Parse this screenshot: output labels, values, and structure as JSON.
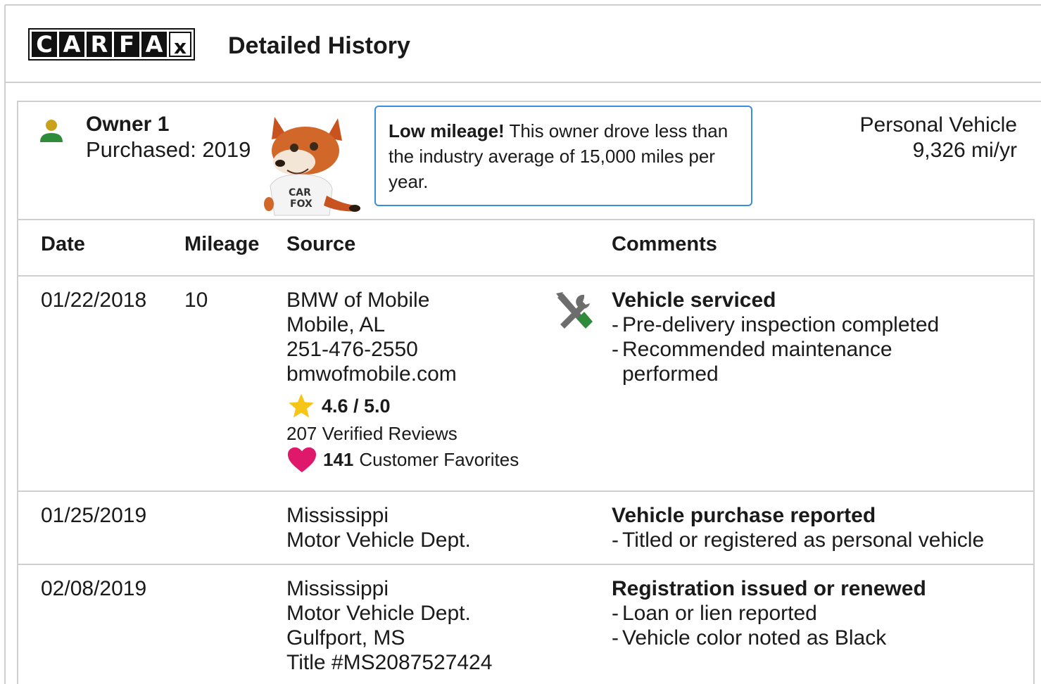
{
  "header": {
    "logo_letters": [
      "C",
      "A",
      "R",
      "F",
      "A",
      "x"
    ],
    "title": "Detailed History"
  },
  "owner": {
    "name": "Owner 1",
    "purchased": "Purchased: 2019",
    "fox_shirt_text": "CAR FOX"
  },
  "callout": {
    "bold": "Low mileage!",
    "text": " This owner drove less than the industry average of 15,000 miles per year."
  },
  "vehicle": {
    "type": "Personal Vehicle",
    "mileage_rate": "9,326 mi/yr"
  },
  "table": {
    "headers": {
      "date": "Date",
      "mileage": "Mileage",
      "source": "Source",
      "comments": "Comments"
    },
    "rows": [
      {
        "date": "01/22/2018",
        "mileage": "10",
        "source_lines": [
          "BMW of Mobile",
          "Mobile, AL",
          "251-476-2550",
          "bmwofmobile.com"
        ],
        "rating": "4.6 / 5.0",
        "reviews": "207 Verified Reviews",
        "favorites_count": "141",
        "favorites_label": "Customer Favorites",
        "comment_title": "Vehicle serviced",
        "comment_lines": [
          "Pre-delivery inspection completed",
          "Recommended maintenance performed"
        ]
      },
      {
        "date": "01/25/2019",
        "mileage": "",
        "source_lines": [
          "Mississippi",
          "Motor Vehicle Dept."
        ],
        "comment_title": "Vehicle purchase reported",
        "comment_lines": [
          "Titled or registered as personal vehicle"
        ]
      },
      {
        "date": "02/08/2019",
        "mileage": "",
        "source_lines": [
          "Mississippi",
          "Motor Vehicle Dept.",
          "Gulfport, MS",
          "Title #MS2087527424"
        ],
        "comment_title": "Registration issued or renewed",
        "comment_lines": [
          "Loan or lien reported",
          "Vehicle color noted as Black"
        ]
      }
    ]
  },
  "colors": {
    "border": "#cfcfcf",
    "callout_border": "#3b8de0",
    "star": "#f5c518",
    "heart": "#e0186c",
    "owner_icon_head": "#c8a21a",
    "owner_icon_body": "#2e8b3a",
    "wrench_green": "#2e8b3a",
    "tool_gray": "#6d6d6d"
  }
}
